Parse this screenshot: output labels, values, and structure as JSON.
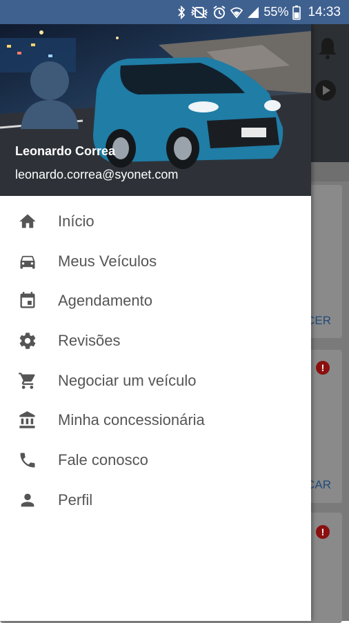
{
  "status_bar": {
    "battery": "55%",
    "time": "14:33",
    "icons": [
      "bluetooth-icon",
      "vibrate-icon",
      "alarm-icon",
      "wifi-icon",
      "signal-icon",
      "battery-icon"
    ]
  },
  "drawer": {
    "user": {
      "name": "Leonardo Correa",
      "email": "leonardo.correa@syonet.com"
    },
    "items": [
      {
        "label": "Início",
        "icon": "home-icon"
      },
      {
        "label": "Meus Veículos",
        "icon": "car-icon"
      },
      {
        "label": "Agendamento",
        "icon": "calendar-icon"
      },
      {
        "label": "Revisões",
        "icon": "gear-icon"
      },
      {
        "label": "Negociar um veículo",
        "icon": "cart-icon"
      },
      {
        "label": "Minha concessionária",
        "icon": "bank-icon"
      },
      {
        "label": "Fale conosco",
        "icon": "phone-icon"
      },
      {
        "label": "Perfil",
        "icon": "person-icon"
      }
    ]
  },
  "background": {
    "card_actions": [
      "CER",
      "CAR"
    ],
    "alert_symbol": "!"
  },
  "colors": {
    "status_bar": "#3f6190",
    "icon": "#555555",
    "text": "#555555",
    "alert": "#8b1010"
  }
}
